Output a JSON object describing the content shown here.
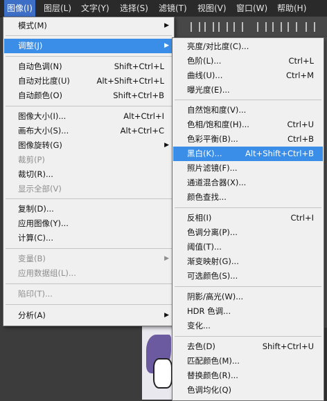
{
  "menubar": {
    "items": [
      {
        "label": "图像(I)"
      },
      {
        "label": "图层(L)"
      },
      {
        "label": "文字(Y)"
      },
      {
        "label": "选择(S)"
      },
      {
        "label": "滤镜(T)"
      },
      {
        "label": "视图(V)"
      },
      {
        "label": "窗口(W)"
      },
      {
        "label": "帮助(H)"
      }
    ]
  },
  "image_menu": {
    "items": [
      {
        "label": "模式(M)",
        "shortcut": "",
        "submenu": "▶"
      },
      {
        "label": "调整(J)",
        "shortcut": "",
        "submenu": "▶"
      },
      {
        "label": "自动色调(N)",
        "shortcut": "Shift+Ctrl+L"
      },
      {
        "label": "自动对比度(U)",
        "shortcut": "Alt+Shift+Ctrl+L"
      },
      {
        "label": "自动颜色(O)",
        "shortcut": "Shift+Ctrl+B"
      },
      {
        "label": "图像大小(I)...",
        "shortcut": "Alt+Ctrl+I"
      },
      {
        "label": "画布大小(S)...",
        "shortcut": "Alt+Ctrl+C"
      },
      {
        "label": "图像旋转(G)",
        "shortcut": "",
        "submenu": "▶"
      },
      {
        "label": "裁剪(P)",
        "shortcut": ""
      },
      {
        "label": "裁切(R)...",
        "shortcut": ""
      },
      {
        "label": "显示全部(V)",
        "shortcut": ""
      },
      {
        "label": "复制(D)...",
        "shortcut": ""
      },
      {
        "label": "应用图像(Y)...",
        "shortcut": ""
      },
      {
        "label": "计算(C)...",
        "shortcut": ""
      },
      {
        "label": "变量(B)",
        "shortcut": "",
        "submenu": "▶"
      },
      {
        "label": "应用数据组(L)...",
        "shortcut": ""
      },
      {
        "label": "陷印(T)...",
        "shortcut": ""
      },
      {
        "label": "分析(A)",
        "shortcut": "",
        "submenu": "▶"
      }
    ]
  },
  "adjust_submenu": {
    "items": [
      {
        "label": "亮度/对比度(C)...",
        "shortcut": ""
      },
      {
        "label": "色阶(L)...",
        "shortcut": "Ctrl+L"
      },
      {
        "label": "曲线(U)...",
        "shortcut": "Ctrl+M"
      },
      {
        "label": "曝光度(E)...",
        "shortcut": ""
      },
      {
        "label": "自然饱和度(V)...",
        "shortcut": ""
      },
      {
        "label": "色相/饱和度(H)...",
        "shortcut": "Ctrl+U"
      },
      {
        "label": "色彩平衡(B)...",
        "shortcut": "Ctrl+B"
      },
      {
        "label": "黑白(K)...",
        "shortcut": "Alt+Shift+Ctrl+B"
      },
      {
        "label": "照片滤镜(F)...",
        "shortcut": ""
      },
      {
        "label": "通道混合器(X)...",
        "shortcut": ""
      },
      {
        "label": "颜色查找...",
        "shortcut": ""
      },
      {
        "label": "反相(I)",
        "shortcut": "Ctrl+I"
      },
      {
        "label": "色调分离(P)...",
        "shortcut": ""
      },
      {
        "label": "阈值(T)...",
        "shortcut": ""
      },
      {
        "label": "渐变映射(G)...",
        "shortcut": ""
      },
      {
        "label": "可选颜色(S)...",
        "shortcut": ""
      },
      {
        "label": "阴影/高光(W)...",
        "shortcut": ""
      },
      {
        "label": "HDR 色调...",
        "shortcut": ""
      },
      {
        "label": "变化...",
        "shortcut": ""
      },
      {
        "label": "去色(D)",
        "shortcut": "Shift+Ctrl+U"
      },
      {
        "label": "匹配颜色(M)...",
        "shortcut": ""
      },
      {
        "label": "替换颜色(R)...",
        "shortcut": ""
      },
      {
        "label": "色调均化(Q)",
        "shortcut": ""
      }
    ]
  },
  "colors": {
    "highlight": "#3a8ee8",
    "menubar_active": "#3d6fc7",
    "menu_bg": "#f0f0f0",
    "disabled": "#8e8e8e"
  }
}
